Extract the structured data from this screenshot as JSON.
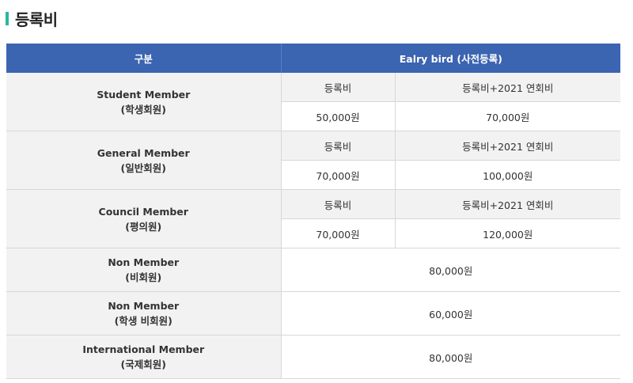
{
  "heading": {
    "title": "등록비",
    "accent_color": "#2bb5a5"
  },
  "table": {
    "header_color": "#3b64b1",
    "headers": {
      "category": "구분",
      "early_bird": "Ealry bird (사전등록)"
    },
    "grouped_rows": [
      {
        "name_en": "Student Member",
        "name_ko": "(학생회원)",
        "sub_headers": [
          "등록비",
          "등록비+2021 연회비"
        ],
        "values": [
          "50,000원",
          "70,000원"
        ]
      },
      {
        "name_en": "General Member",
        "name_ko": "(일반회원)",
        "sub_headers": [
          "등록비",
          "등록비+2021 연회비"
        ],
        "values": [
          "70,000원",
          "100,000원"
        ]
      },
      {
        "name_en": "Council Member",
        "name_ko": "(평의원)",
        "sub_headers": [
          "등록비",
          "등록비+2021 연회비"
        ],
        "values": [
          "70,000원",
          "120,000원"
        ]
      }
    ],
    "single_rows": [
      {
        "name_en": "Non Member",
        "name_ko": "(비회원)",
        "fee": "80,000원"
      },
      {
        "name_en": "Non Member",
        "name_ko": "(학생 비회원)",
        "fee": "60,000원"
      },
      {
        "name_en": "International Member",
        "name_ko": "(국제회원)",
        "fee": "80,000원"
      }
    ]
  }
}
